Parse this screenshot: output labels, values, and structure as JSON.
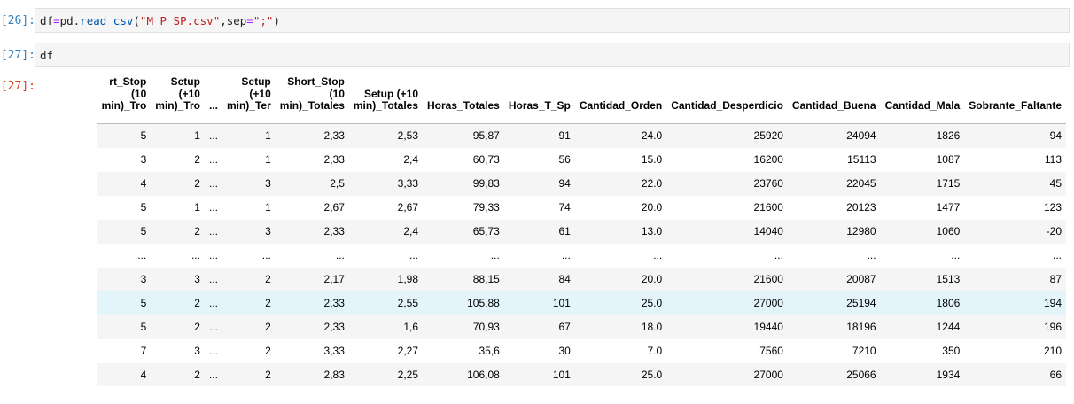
{
  "cells": [
    {
      "prompt": "[26]:",
      "code_parts": {
        "a": "df",
        "op1": "=",
        "b": "pd.",
        "fn": "read_csv",
        "c": "(",
        "s1": "\"M_P_SP.csv\"",
        "d": ",sep",
        "op2": "=",
        "s2": "\";\"",
        "e": ")"
      }
    },
    {
      "prompt": "[27]:",
      "code": "df"
    }
  ],
  "output": {
    "prompt": "[27]:",
    "columns": [
      [
        "rt_Stop",
        "(10",
        "min)_Tro"
      ],
      [
        "Setup",
        "(+10",
        "min)_Tro"
      ],
      [
        "..."
      ],
      [
        "Setup",
        "(+10",
        "min)_Ter"
      ],
      [
        "Short_Stop",
        "(10",
        "min)_Totales"
      ],
      [
        "Setup (+10",
        "min)_Totales"
      ],
      [
        "Horas_Totales"
      ],
      [
        "Horas_T_Sp"
      ],
      [
        "Cantidad_Orden"
      ],
      [
        "Cantidad_Desperdicio"
      ],
      [
        "Cantidad_Buena"
      ],
      [
        "Cantidad_Mala"
      ],
      [
        "Sobrante_Faltante"
      ]
    ],
    "rows": [
      [
        "5",
        "1",
        "...",
        "1",
        "2,33",
        "2,53",
        "95,87",
        "91",
        "24.0",
        "25920",
        "24094",
        "1826",
        "94"
      ],
      [
        "3",
        "2",
        "...",
        "1",
        "2,33",
        "2,4",
        "60,73",
        "56",
        "15.0",
        "16200",
        "15113",
        "1087",
        "113"
      ],
      [
        "4",
        "2",
        "...",
        "3",
        "2,5",
        "3,33",
        "99,83",
        "94",
        "22.0",
        "23760",
        "22045",
        "1715",
        "45"
      ],
      [
        "5",
        "1",
        "...",
        "1",
        "2,67",
        "2,67",
        "79,33",
        "74",
        "20.0",
        "21600",
        "20123",
        "1477",
        "123"
      ],
      [
        "5",
        "2",
        "...",
        "3",
        "2,33",
        "2,4",
        "65,73",
        "61",
        "13.0",
        "14040",
        "12980",
        "1060",
        "-20"
      ],
      [
        "...",
        "...",
        "...",
        "...",
        "...",
        "...",
        "...",
        "...",
        "...",
        "...",
        "...",
        "...",
        "..."
      ],
      [
        "3",
        "3",
        "...",
        "2",
        "2,17",
        "1,98",
        "88,15",
        "84",
        "20.0",
        "21600",
        "20087",
        "1513",
        "87"
      ],
      [
        "5",
        "2",
        "...",
        "2",
        "2,33",
        "2,55",
        "105,88",
        "101",
        "25.0",
        "27000",
        "25194",
        "1806",
        "194"
      ],
      [
        "5",
        "2",
        "...",
        "2",
        "2,33",
        "1,6",
        "70,93",
        "67",
        "18.0",
        "19440",
        "18196",
        "1244",
        "196"
      ],
      [
        "7",
        "3",
        "...",
        "2",
        "3,33",
        "2,27",
        "35,6",
        "30",
        "7.0",
        "7560",
        "7210",
        "350",
        "210"
      ],
      [
        "4",
        "2",
        "...",
        "2",
        "2,83",
        "2,25",
        "106,08",
        "101",
        "25.0",
        "27000",
        "25066",
        "1934",
        "66"
      ]
    ],
    "hovered_row": 7
  }
}
